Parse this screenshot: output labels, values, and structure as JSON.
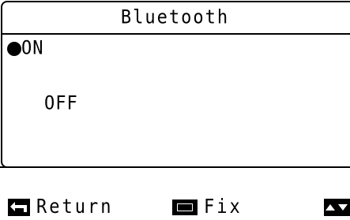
{
  "header": {
    "title": "Bluetooth"
  },
  "options": [
    {
      "label": "ON",
      "selected": true
    },
    {
      "label": "OFF",
      "selected": false
    }
  ],
  "footer": {
    "return_label": "Return",
    "fix_label": "Fix"
  },
  "icons": {
    "selected": "filled-circle-icon",
    "return": "return-arrow-icon",
    "fix": "rectangle-button-icon",
    "navigate": "up-down-arrow-icon"
  }
}
